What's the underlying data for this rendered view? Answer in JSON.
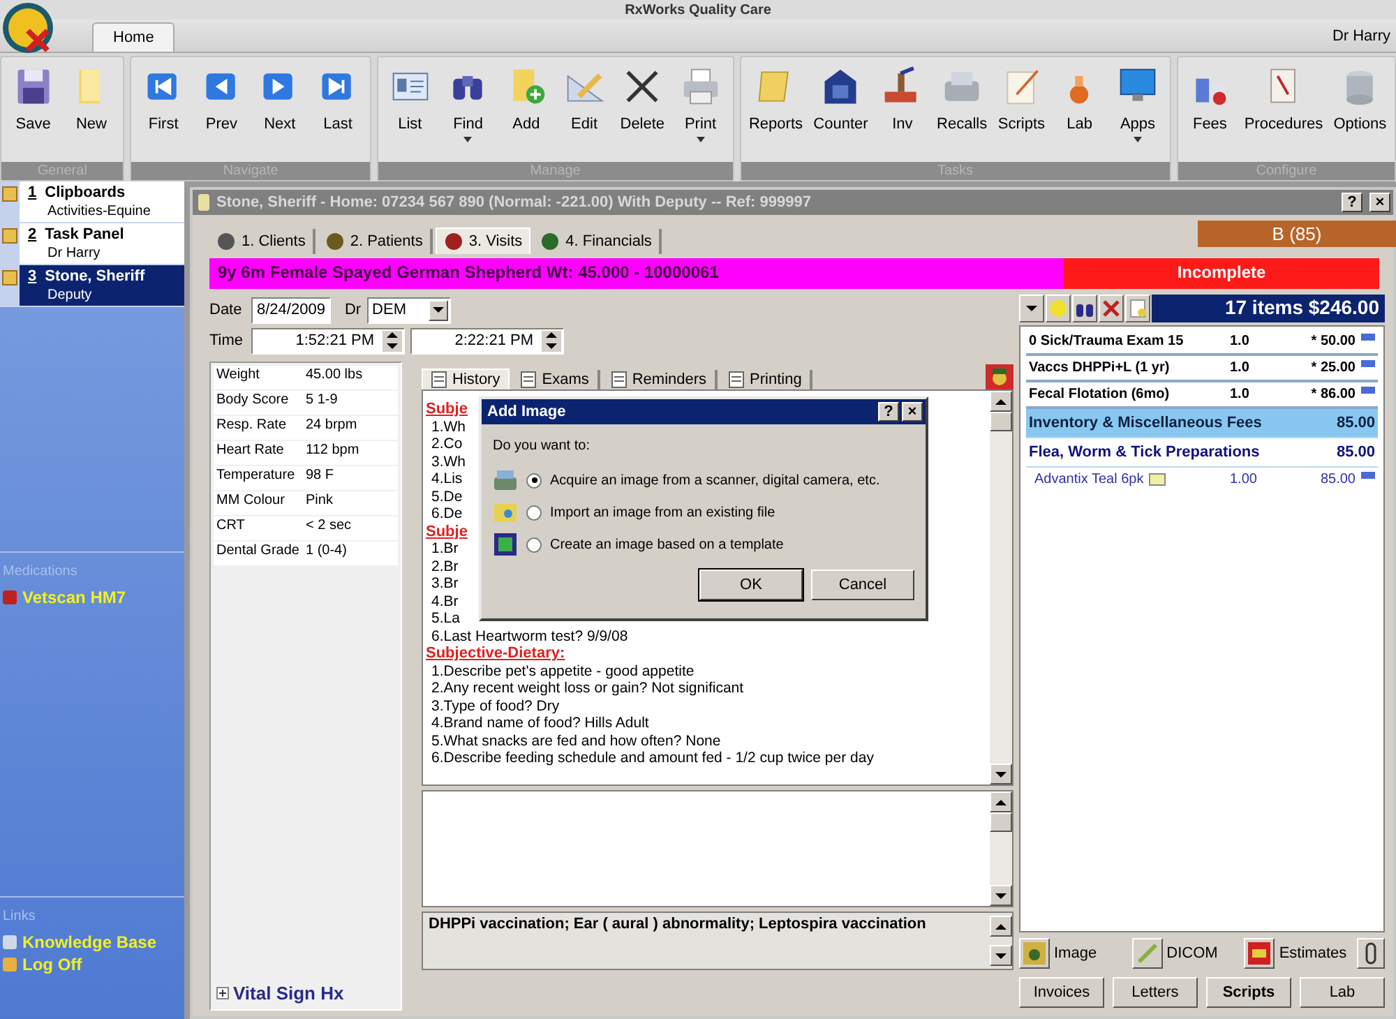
{
  "app": {
    "title": "RxWorks Quality Care",
    "user": "Dr Harry"
  },
  "ribbon_tabs": [
    {
      "label": "Home",
      "selected": true
    }
  ],
  "ribbon_groups": [
    {
      "label": "General",
      "buttons": [
        {
          "label": "Save",
          "dropdown": false
        },
        {
          "label": "New",
          "dropdown": false
        }
      ]
    },
    {
      "label": "Navigate",
      "buttons": [
        {
          "label": "First",
          "dropdown": false
        },
        {
          "label": "Prev",
          "dropdown": false
        },
        {
          "label": "Next",
          "dropdown": false
        },
        {
          "label": "Last",
          "dropdown": false
        }
      ]
    },
    {
      "label": "Manage",
      "buttons": [
        {
          "label": "List",
          "dropdown": false
        },
        {
          "label": "Find",
          "dropdown": true
        },
        {
          "label": "Add",
          "dropdown": false
        },
        {
          "label": "Edit",
          "dropdown": false
        },
        {
          "label": "Delete",
          "dropdown": false
        },
        {
          "label": "Print",
          "dropdown": true
        }
      ]
    },
    {
      "label": "Tasks",
      "buttons": [
        {
          "label": "Reports",
          "dropdown": false
        },
        {
          "label": "Counter",
          "dropdown": false
        },
        {
          "label": "Inv",
          "dropdown": false
        },
        {
          "label": "Recalls",
          "dropdown": false
        },
        {
          "label": "Scripts",
          "dropdown": false
        },
        {
          "label": "Lab",
          "dropdown": false
        },
        {
          "label": "Apps",
          "dropdown": true
        }
      ]
    },
    {
      "label": "Configure",
      "buttons": [
        {
          "label": "Fees",
          "dropdown": false
        },
        {
          "label": "Procedures",
          "dropdown": false
        },
        {
          "label": "Options",
          "dropdown": false
        }
      ]
    }
  ],
  "sidebar": {
    "items": [
      {
        "number": "1",
        "title": "Clipboards",
        "subtitle": "Activities-Equine",
        "selected": false
      },
      {
        "number": "2",
        "title": "Task Panel",
        "subtitle": "Dr Harry",
        "selected": false
      },
      {
        "number": "3",
        "title": "Stone, Sheriff",
        "subtitle": "Deputy",
        "selected": true
      }
    ],
    "sections": [
      {
        "heading": "Medications",
        "links": [
          "Vetscan HM7"
        ]
      },
      {
        "heading": "Links",
        "links": [
          "Knowledge Base",
          "Log Off"
        ]
      }
    ]
  },
  "window": {
    "title": "Stone, Sheriff - Home: 07234 567 890 (Normal: -221.00) With Deputy -- Ref: 999997",
    "title_buttons": [
      "?",
      "×"
    ],
    "tabs": [
      {
        "label": "1. Clients",
        "selected": false
      },
      {
        "label": "2. Patients",
        "selected": false
      },
      {
        "label": "3. Visits",
        "selected": true
      },
      {
        "label": "4. Financials",
        "selected": false
      }
    ],
    "badge": "B (85)",
    "patient_banner": "9y 6m Female Spayed German Shepherd  Wt: 45.000 - 10000061",
    "status": "Incomplete",
    "date": {
      "label": "Date",
      "value": "8/24/2009"
    },
    "doctor": {
      "label": "Dr",
      "value": "DEM"
    },
    "time": {
      "label": "Time",
      "start": "1:52:21 PM",
      "end": "2:22:21 PM"
    },
    "vitals": [
      {
        "label": "Weight",
        "value": "45.00 lbs"
      },
      {
        "label": "Body Score",
        "value": "5 1-9"
      },
      {
        "label": "Resp. Rate",
        "value": "24 brpm"
      },
      {
        "label": "Heart Rate",
        "value": "112 bpm"
      },
      {
        "label": "Temperature",
        "value": "98 F"
      },
      {
        "label": "MM Colour",
        "value": "Pink"
      },
      {
        "label": "CRT",
        "value": "< 2 sec"
      },
      {
        "label": "Dental Grade",
        "value": "1 (0-4)"
      }
    ],
    "vital_history_link": "Vital Sign Hx",
    "note_tabs": [
      {
        "label": "History",
        "selected": true
      },
      {
        "label": "Exams",
        "selected": false
      },
      {
        "label": "Reminders",
        "selected": false
      },
      {
        "label": "Printing",
        "selected": false
      }
    ],
    "history": [
      {
        "kind": "heading",
        "text": "Subje"
      },
      {
        "kind": "line",
        "text": "1.Wh"
      },
      {
        "kind": "line",
        "text": "2.Co"
      },
      {
        "kind": "line",
        "text": "3.Wh"
      },
      {
        "kind": "line",
        "text": "4.Lis"
      },
      {
        "kind": "line",
        "text": "5.De"
      },
      {
        "kind": "line",
        "text": "6.De"
      },
      {
        "kind": "heading",
        "text": "Subje"
      },
      {
        "kind": "line",
        "text": "1.Br"
      },
      {
        "kind": "line",
        "text": "2.Br"
      },
      {
        "kind": "line",
        "text": "3.Br"
      },
      {
        "kind": "line",
        "text": "4.Br"
      },
      {
        "kind": "line",
        "text": "5.La"
      },
      {
        "kind": "line",
        "text": "6.Last Heartworm test? 9/9/08"
      },
      {
        "kind": "heading",
        "text": "Subjective-Dietary:"
      },
      {
        "kind": "line",
        "text": "1.Describe pet's appetite - good appetite"
      },
      {
        "kind": "line",
        "text": "2.Any recent weight loss or gain? Not significant"
      },
      {
        "kind": "line",
        "text": "3.Type of food? Dry"
      },
      {
        "kind": "line",
        "text": "4.Brand name of food?  Hills Adult"
      },
      {
        "kind": "line",
        "text": "5.What snacks are fed and how often? None"
      },
      {
        "kind": "line",
        "text": "6.Describe feeding schedule and amount fed - 1/2 cup twice per day"
      }
    ],
    "diagnosis": "DHPPi vaccination; Ear ( aural ) abnormality; Leptospira vaccination",
    "invoice": {
      "summary": "17 items $246.00",
      "rows": [
        {
          "kind": "item",
          "name": "0 Sick/Trauma Exam 15",
          "qty": "1.0",
          "price": "* 50.00",
          "selected": false
        },
        {
          "kind": "item",
          "name": "Vaccs DHPPi+L (1 yr)",
          "qty": "1.0",
          "price": "* 25.00",
          "selected": false
        },
        {
          "kind": "item",
          "name": "Fecal Flotation (6mo)",
          "qty": "1.0",
          "price": "* 86.00",
          "selected": false
        },
        {
          "kind": "category",
          "name": "Inventory & Miscellaneous Fees",
          "price": "85.00",
          "selected": true
        },
        {
          "kind": "category",
          "name": "Flea, Worm & Tick Preparations",
          "price": "85.00",
          "selected": false
        },
        {
          "kind": "subitem",
          "name": "Advantix Teal 6pk",
          "qty": "1.00",
          "price": "85.00",
          "selected": false
        }
      ]
    },
    "tool_buttons": [
      "Image",
      "DICOM",
      "Estimates"
    ],
    "action_buttons": [
      {
        "label": "Invoices",
        "bold": false
      },
      {
        "label": "Letters",
        "bold": false
      },
      {
        "label": "Scripts",
        "bold": true
      },
      {
        "label": "Lab",
        "bold": false
      }
    ]
  },
  "dialog": {
    "title": "Add Image",
    "title_buttons": [
      "?",
      "×"
    ],
    "prompt": "Do you want to:",
    "options": [
      {
        "label": "Acquire an image from a scanner, digital camera, etc.",
        "selected": true
      },
      {
        "label": "Import an image from an existing file",
        "selected": false
      },
      {
        "label": "Create an image based on a template",
        "selected": false
      }
    ],
    "buttons": [
      "OK",
      "Cancel"
    ]
  }
}
